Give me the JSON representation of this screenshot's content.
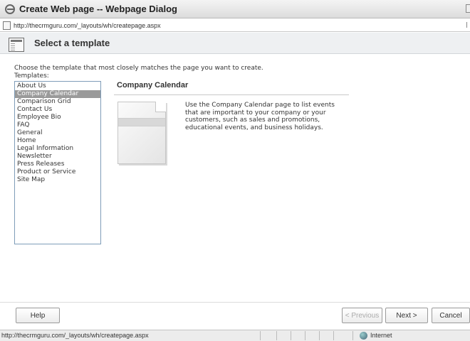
{
  "window": {
    "title": "Create Web page -- Webpage Dialog",
    "address": "http://thecrmguru.com/_layouts/wh/createpage.aspx"
  },
  "header": {
    "title": "Select a template"
  },
  "main": {
    "instruction": "Choose the template that most closely matches the page you want to create.",
    "templates_label": "Templates:",
    "templates": [
      "About Us",
      "Company Calendar",
      "Comparison Grid",
      "Contact Us",
      "Employee Bio",
      "FAQ",
      "General",
      "Home",
      "Legal Information",
      "Newsletter",
      "Press Releases",
      "Product or Service",
      "Site Map"
    ],
    "selected_template": "Company Calendar",
    "preview": {
      "title": "Company Calendar",
      "description": "Use the Company Calendar page to list events that are important to your company or your customers, such as sales and promotions, educational events, and business holidays."
    }
  },
  "buttons": {
    "help": "Help",
    "previous": "< Previous",
    "next": "Next >",
    "cancel": "Cancel"
  },
  "statusbar": {
    "url": "http://thecrmguru.com/_layouts/wh/createpage.aspx",
    "zone": "Internet"
  },
  "colors": {
    "selection": "#9a9a9a",
    "list_border": "#7f9db9",
    "header_band": "#eef0f2"
  }
}
